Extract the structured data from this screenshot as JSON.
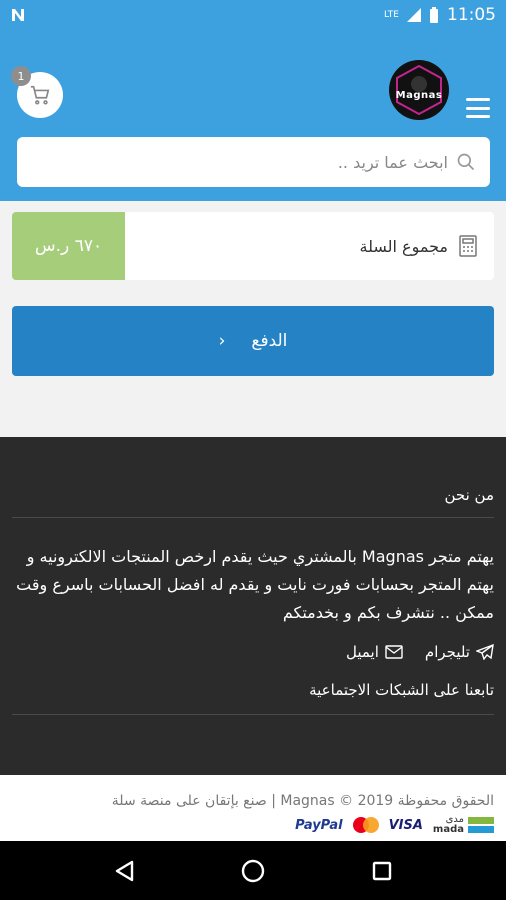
{
  "status_bar": {
    "time": "11:05",
    "network": "LTE"
  },
  "header": {
    "cart_count": "1",
    "logo_text": "Magnas",
    "search_placeholder": "ابحث عما تريد .."
  },
  "cart": {
    "total_label": "مجموع السلة",
    "total_amount": "٦٧٠ ر.س",
    "pay_label": "الدفع"
  },
  "footer": {
    "about_title": "من نحن",
    "about_text": "يهتم متجر Magnas بالمشتري حيث يقدم ارخص المنتجات الالكترونيه و يهتم المتجر بحسابات فورت نايت و يقدم له افضل الحسابات باسرع وقت ممكن .. نتشرف بكم و بخدمتكم",
    "telegram_label": "تليجرام",
    "email_label": "ايميل",
    "follow_label": "تابعنا على الشبكات الاجتماعية",
    "copyright": "الحقوق محفوظة 2019 © Magnas | صنع بإتقان على منصة سلة",
    "payment_methods": {
      "mada": "mada",
      "mada_ar": "مدى",
      "visa": "VISA",
      "paypal": "PayPal"
    }
  },
  "colors": {
    "primary": "#3ea1df",
    "pay_button": "#2582c4",
    "total_bg": "#a6cd7a",
    "footer_bg": "#2b2b2b"
  }
}
